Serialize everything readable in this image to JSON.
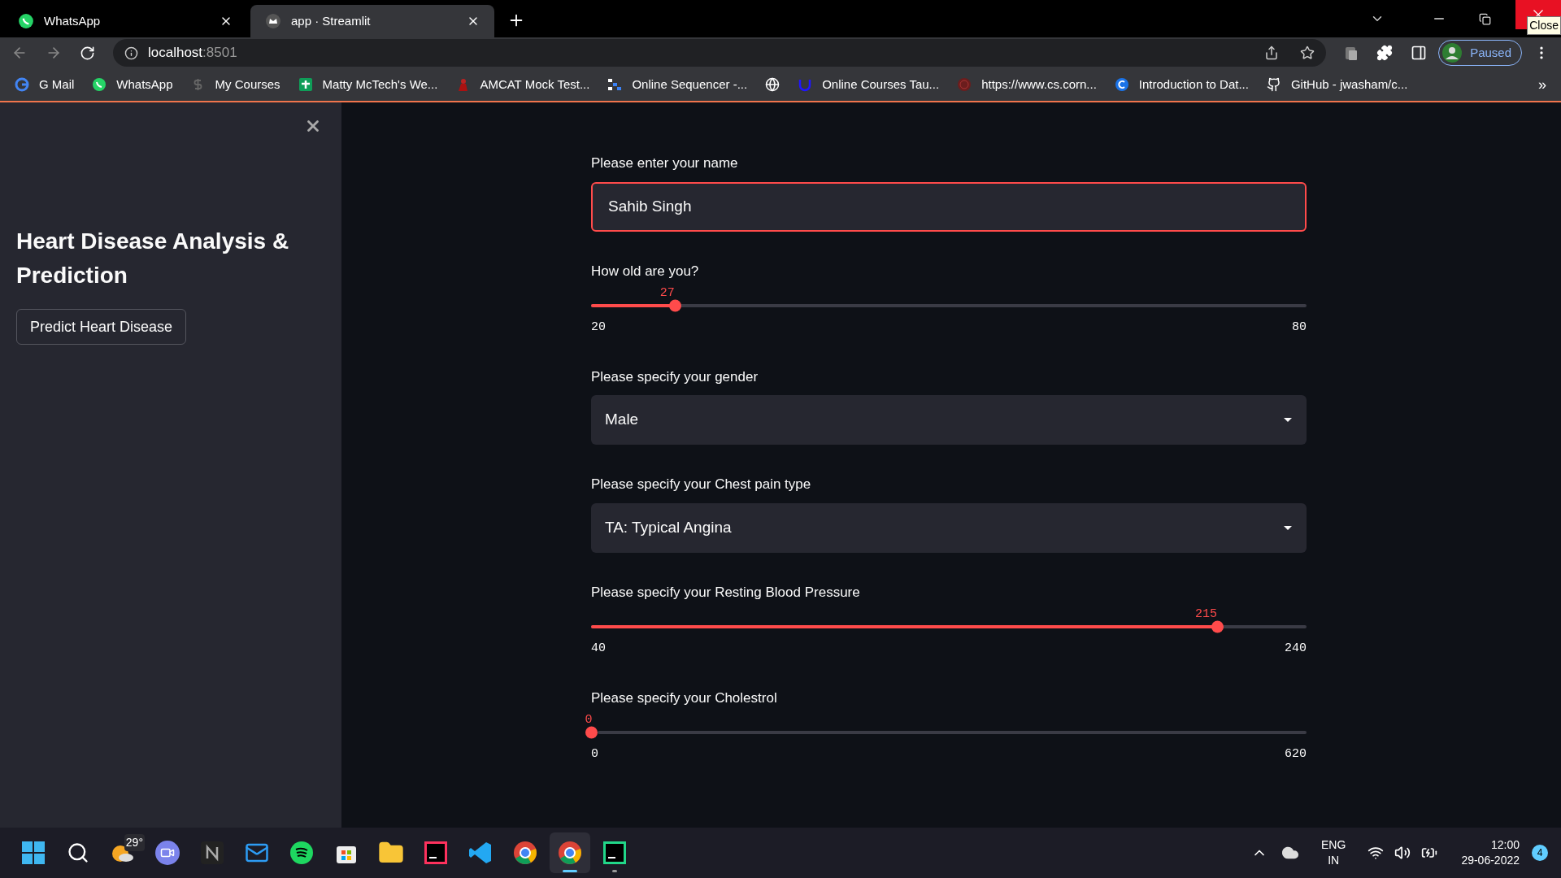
{
  "browser": {
    "tabs": [
      {
        "title": "WhatsApp",
        "selected": false
      },
      {
        "title": "app · Streamlit",
        "selected": true
      }
    ],
    "url_host": "localhost",
    "url_port": ":8501",
    "profile": "Paused",
    "tooltip": "Close",
    "bookmarks": [
      {
        "label": "G Mail"
      },
      {
        "label": "WhatsApp"
      },
      {
        "label": "My Courses"
      },
      {
        "label": "Matty McTech's We..."
      },
      {
        "label": "AMCAT Mock Test..."
      },
      {
        "label": "Online Sequencer -..."
      },
      {
        "label": "Online Courses Tau..."
      },
      {
        "label": "https://www.cs.corn..."
      },
      {
        "label": "Introduction to Dat..."
      },
      {
        "label": "GitHub - jwasham/c..."
      }
    ],
    "more": "»"
  },
  "sidebar": {
    "title": "Heart Disease Analysis & Prediction",
    "button": "Predict Heart Disease"
  },
  "widgets": [
    {
      "kind": "text_input",
      "label": "Please enter your name",
      "value": "Sahib Singh",
      "focused": true
    },
    {
      "kind": "slider",
      "label": "How old are you?",
      "value": "27",
      "min": "20",
      "max": "80",
      "level": 0.1167
    },
    {
      "kind": "select",
      "label": "Please specify your gender",
      "value": "Male"
    },
    {
      "kind": "select",
      "label": "Please specify your Chest pain type",
      "value": "TA: Typical Angina"
    },
    {
      "kind": "slider",
      "label": "Please specify your Resting Blood Pressure",
      "value": "215",
      "min": "40",
      "max": "240",
      "level": 0.875
    },
    {
      "kind": "slider",
      "label": "Please specify your Cholestrol",
      "value": "0",
      "min": "0",
      "max": "620",
      "level": 0
    }
  ],
  "taskbar": {
    "weather": "29°",
    "language": "ENG",
    "region": "IN",
    "time": "12:00",
    "date": "29-06-2022",
    "notifications": "4"
  }
}
